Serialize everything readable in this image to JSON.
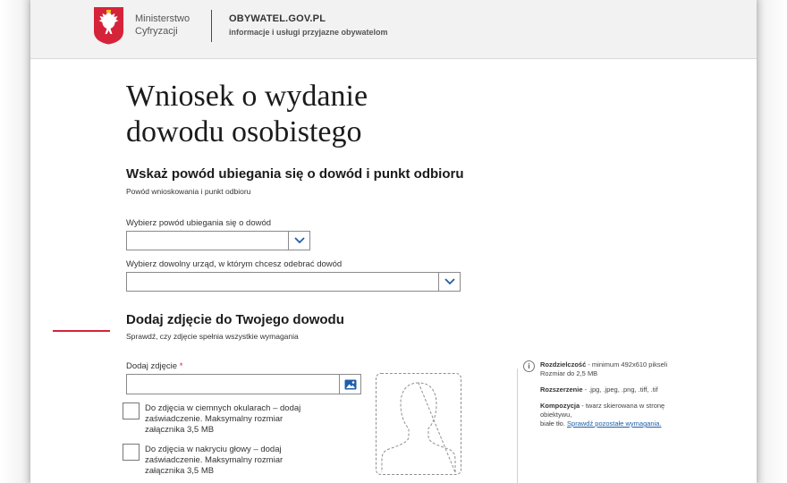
{
  "header": {
    "ministry_line1": "Ministerstwo",
    "ministry_line2": "Cyfryzacji",
    "portal_name": "OBYWATEL.GOV.PL",
    "portal_tagline": "informacje i usługi przyjazne obywatelom"
  },
  "title_line1": "Wniosek o wydanie",
  "title_line2": "dowodu osobistego",
  "section1": {
    "heading": "Wskaż powód ubiegania się o dowód i punkt odbioru",
    "subheading": "Powód wnioskowania i punkt odbioru",
    "reason_label": "Wybierz powód ubiegania się o dowód",
    "reason_value": "",
    "office_label": "Wybierz dowolny urząd, w którym chcesz odebrać dowód",
    "office_value": ""
  },
  "section2": {
    "heading": "Dodaj zdjęcie do Twojego dowodu",
    "subheading": "Sprawdź, czy zdjęcie spełnia wszystkie wymagania",
    "photo_label": "Dodaj zdjęcie",
    "required_mark": "*",
    "photo_value": "",
    "checkbox_sunglasses": {
      "line1": "Do zdjęcia w ciemnych okularach – dodaj",
      "line2": "zaświadczenie. Maksymalny rozmiar",
      "line3": "załącznika 3,5 MB",
      "checked": false
    },
    "checkbox_headwear": {
      "line1": "Do zdjęcia w nakryciu głowy – dodaj",
      "line2": "zaświadczenie. Maksymalny rozmiar",
      "line3": "załącznika 3,5 MB",
      "checked": false
    }
  },
  "requirements": {
    "info_icon": "i",
    "resolution_label": "Rozdzielczość",
    "resolution_value": " - minimum 492x610 pikseli",
    "size_value": "Rozmiar do 2,5 MB",
    "extension_label": "Rozszerzenie",
    "extension_value": " - .jpg, .jpeg, .png, .tiff, .tif",
    "composition_label": "Kompozycja",
    "composition_value": " - twarz skierowana w stronę obiektywu,",
    "composition_value2": "białe tło. ",
    "more_link": "Sprawdź pozostałe wymagania."
  },
  "colors": {
    "accent_red": "#d5233a",
    "link_blue": "#1f5fa8",
    "header_bg": "#f2f2f2"
  },
  "icons": {
    "select_chevron": "chevron-down-icon",
    "photo_upload": "image-icon",
    "info": "info-icon"
  }
}
